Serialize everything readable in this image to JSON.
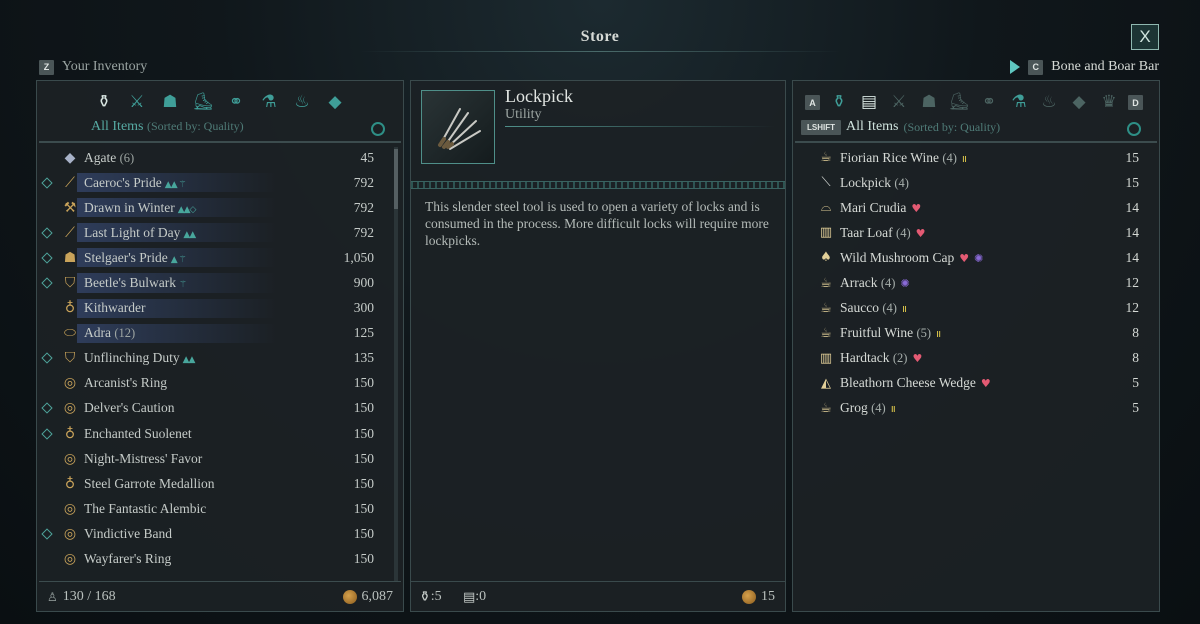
{
  "title": "Store",
  "close_label": "X",
  "inventory": {
    "key": "Z",
    "label": "Your Inventory",
    "category_icons": [
      "bag-icon",
      "sword-icon",
      "armor-icon",
      "boot-icon",
      "ring-icon",
      "potion-icon",
      "lamp-icon",
      "gem-icon"
    ],
    "filter_label": "All Items",
    "sort_label": "(Sorted by: Quality)",
    "items": [
      {
        "name": "Agate",
        "count": "(6)",
        "value": "45",
        "icon": "gem-icon",
        "equipped": false,
        "highlight": false,
        "perk": ""
      },
      {
        "name": "Caeroc's Pride",
        "count": "",
        "value": "792",
        "icon": "sword-icon",
        "equipped": true,
        "highlight": true,
        "perk": "▲▲ ⚚"
      },
      {
        "name": "Drawn in Winter",
        "count": "",
        "value": "792",
        "icon": "hammer-icon",
        "equipped": false,
        "highlight": true,
        "perk": "▲▲◇"
      },
      {
        "name": "Last Light of Day",
        "count": "",
        "value": "792",
        "icon": "sword-icon",
        "equipped": true,
        "highlight": true,
        "perk": "▲▲"
      },
      {
        "name": "Stelgaer's Pride",
        "count": "",
        "value": "1,050",
        "icon": "armor-icon",
        "equipped": true,
        "highlight": true,
        "perk": "▲ ⚚"
      },
      {
        "name": "Beetle's Bulwark",
        "count": "",
        "value": "900",
        "icon": "shield-icon",
        "equipped": true,
        "highlight": true,
        "perk": "⚚"
      },
      {
        "name": "Kithwarder",
        "count": "",
        "value": "300",
        "icon": "amulet-icon",
        "equipped": false,
        "highlight": true,
        "perk": ""
      },
      {
        "name": "Adra",
        "count": "(12)",
        "value": "125",
        "icon": "ore-icon",
        "equipped": false,
        "highlight": true,
        "perk": ""
      },
      {
        "name": "Unflinching Duty",
        "count": "",
        "value": "135",
        "icon": "shield-icon",
        "equipped": true,
        "highlight": false,
        "perk": "▲▲"
      },
      {
        "name": "Arcanist's Ring",
        "count": "",
        "value": "150",
        "icon": "ring-icon",
        "equipped": false,
        "highlight": false,
        "perk": ""
      },
      {
        "name": "Delver's Caution",
        "count": "",
        "value": "150",
        "icon": "ring-icon",
        "equipped": true,
        "highlight": false,
        "perk": ""
      },
      {
        "name": "Enchanted Suolenet",
        "count": "",
        "value": "150",
        "icon": "amulet-icon",
        "equipped": true,
        "highlight": false,
        "perk": ""
      },
      {
        "name": "Night-Mistress' Favor",
        "count": "",
        "value": "150",
        "icon": "ring-icon",
        "equipped": false,
        "highlight": false,
        "perk": ""
      },
      {
        "name": "Steel Garrote Medallion",
        "count": "",
        "value": "150",
        "icon": "amulet-icon",
        "equipped": false,
        "highlight": false,
        "perk": ""
      },
      {
        "name": "The Fantastic Alembic",
        "count": "",
        "value": "150",
        "icon": "ring-icon",
        "equipped": false,
        "highlight": false,
        "perk": ""
      },
      {
        "name": "Vindictive Band",
        "count": "",
        "value": "150",
        "icon": "ring-icon",
        "equipped": true,
        "highlight": false,
        "perk": ""
      },
      {
        "name": "Wayfarer's Ring",
        "count": "",
        "value": "150",
        "icon": "ring-icon",
        "equipped": false,
        "highlight": false,
        "perk": ""
      }
    ],
    "weight": "130 / 168",
    "gold": "6,087"
  },
  "selected_item": {
    "name": "Lockpick",
    "type": "Utility",
    "description": "This slender steel tool is used to open a variety of locks and is consumed in the process. More difficult locks will require more lockpicks.",
    "stat_a": ":5",
    "stat_b": ":0",
    "price": "15"
  },
  "vendor": {
    "key_shortcut": "C",
    "name": "Bone and Boar Bar",
    "key_left": "A",
    "key_right": "D",
    "key_shift": "LSHIFT",
    "filter_label": "All Items",
    "sort_label": "(Sorted by: Quality)",
    "items": [
      {
        "name": "Fiorian Rice Wine",
        "count": "(4)",
        "value": "15",
        "icon": "drink-icon",
        "perk": "bars"
      },
      {
        "name": "Lockpick",
        "count": "(4)",
        "value": "15",
        "icon": "lockpick-icon",
        "perk": ""
      },
      {
        "name": "Mari Crudia",
        "count": "",
        "value": "14",
        "icon": "dish-icon",
        "perk": "heart"
      },
      {
        "name": "Taar Loaf",
        "count": "(4)",
        "value": "14",
        "icon": "bread-icon",
        "perk": "heart"
      },
      {
        "name": "Wild Mushroom Cap",
        "count": "",
        "value": "14",
        "icon": "mushroom-icon",
        "perk": "heart-spiral"
      },
      {
        "name": "Arrack",
        "count": "(4)",
        "value": "12",
        "icon": "drink-icon",
        "perk": "spiral"
      },
      {
        "name": "Saucco",
        "count": "(4)",
        "value": "12",
        "icon": "drink-icon",
        "perk": "bars"
      },
      {
        "name": "Fruitful Wine",
        "count": "(5)",
        "value": "8",
        "icon": "drink-icon",
        "perk": "bars"
      },
      {
        "name": "Hardtack",
        "count": "(2)",
        "value": "8",
        "icon": "bread-icon",
        "perk": "heart"
      },
      {
        "name": "Bleathorn Cheese Wedge",
        "count": "",
        "value": "5",
        "icon": "cheese-icon",
        "perk": "heart"
      },
      {
        "name": "Grog",
        "count": "(4)",
        "value": "5",
        "icon": "drink-icon",
        "perk": "bars"
      }
    ]
  }
}
